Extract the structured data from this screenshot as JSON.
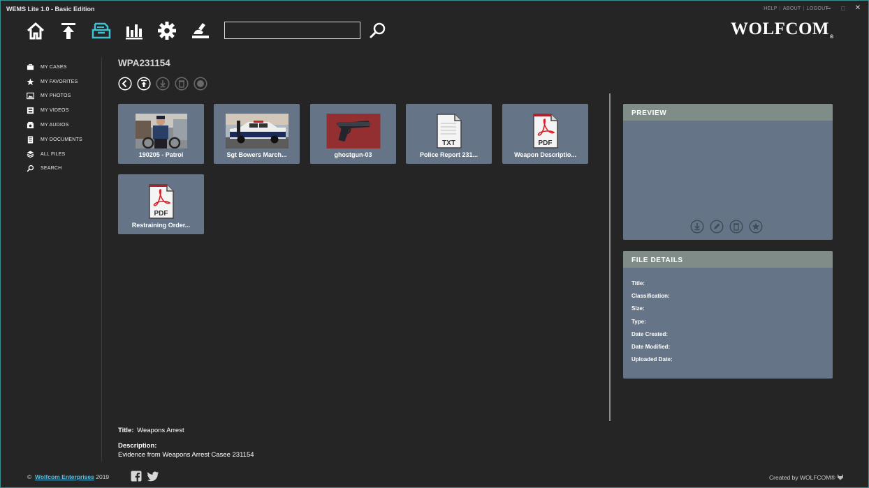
{
  "window": {
    "title": "WEMS Lite 1.0 - Basic Edition",
    "links": [
      "HELP",
      "ABOUT",
      "LOGOUT"
    ],
    "controls": [
      "–",
      "□",
      "✕"
    ]
  },
  "toolbar": {
    "search_value": "",
    "brand": "WOLFCOM",
    "brand_mark": "®"
  },
  "sidebar": {
    "items": [
      {
        "label": "MY CASES",
        "icon": "briefcase-icon"
      },
      {
        "label": "MY FAVORITES",
        "icon": "star-icon"
      },
      {
        "label": "MY PHOTOS",
        "icon": "photo-icon"
      },
      {
        "label": "MY VIDEOS",
        "icon": "film-icon"
      },
      {
        "label": "MY AUDIOS",
        "icon": "audio-icon"
      },
      {
        "label": "MY DOCUMENTS",
        "icon": "document-icon"
      },
      {
        "label": "ALL FILES",
        "icon": "layers-icon"
      },
      {
        "label": "SEARCH",
        "icon": "search-icon"
      }
    ]
  },
  "case": {
    "id": "WPA231154",
    "title_label": "Title:",
    "title_value": "Weapons Arrest",
    "description_label": "Description:",
    "description_value": "Evidence from Weapons Arrest Casee 231154"
  },
  "files": [
    {
      "label": "190205 - Patrol",
      "kind": "photo"
    },
    {
      "label": "Sgt Bowers March...",
      "kind": "photo"
    },
    {
      "label": "ghostgun-03",
      "kind": "photo"
    },
    {
      "label": "Police Report 231...",
      "kind": "txt",
      "badge": "TXT"
    },
    {
      "label": "Weapon Descriptio...",
      "kind": "pdf",
      "badge": "PDF"
    },
    {
      "label": "Restraining Order...",
      "kind": "pdf",
      "badge": "PDF"
    }
  ],
  "preview": {
    "header": "PREVIEW"
  },
  "file_details": {
    "header": "FILE DETAILS",
    "fields": [
      "Title:",
      "Classification:",
      "Size:",
      "Type:",
      "Date Created:",
      "Date Modified:",
      "Uploaded Date:"
    ]
  },
  "footer": {
    "copyright": "©",
    "company": "Wolfcom Enterprises",
    "year": "2019",
    "created_by": "Created by WOLFCOM®"
  },
  "colors": {
    "background": "#252526",
    "tile": "#657587",
    "panel_header": "#808c87",
    "accent_active": "#3ec1d3",
    "link": "#4fc3e8"
  }
}
